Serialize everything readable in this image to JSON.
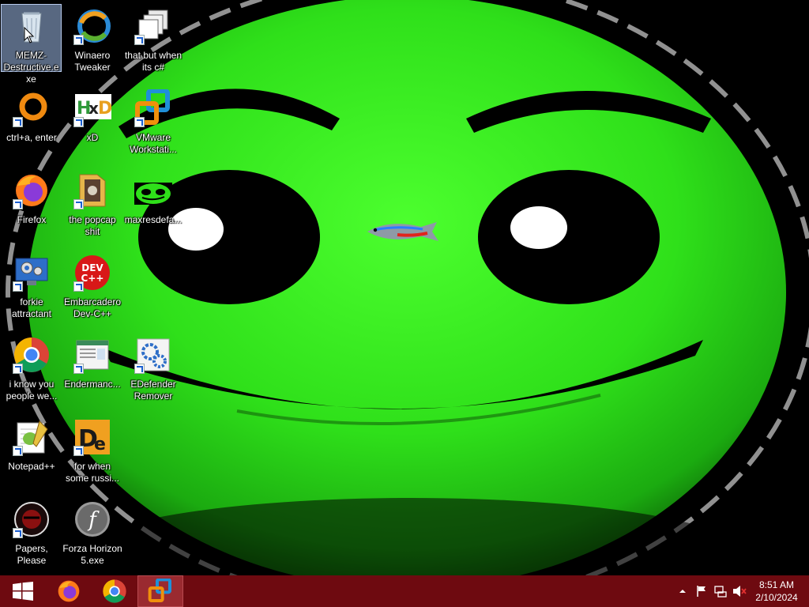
{
  "desktop": {
    "icons": [
      {
        "label": "MEMZ-Destructive.exe",
        "icon": "recycle-bin-icon"
      },
      {
        "label": "Winaero Tweaker",
        "icon": "winaero-icon"
      },
      {
        "label": "that but when its c#",
        "icon": "stacked-windows-icon"
      },
      {
        "label": "ctrl+a, enter",
        "icon": "orange-ring-icon"
      },
      {
        "label": "xD",
        "icon": "hxd-icon"
      },
      {
        "label": "VMware Workstati...",
        "icon": "vmware-icon"
      },
      {
        "label": "Firefox",
        "icon": "firefox-icon"
      },
      {
        "label": "the popcap shit",
        "icon": "folder-icon"
      },
      {
        "label": "maxresdefa...",
        "icon": "green-face-thumbnail-icon"
      },
      {
        "label": "forkie attractant",
        "icon": "monitor-gear-icon"
      },
      {
        "label": "Embarcadero Dev-C++",
        "icon": "devcpp-icon"
      },
      {
        "label": "i know you people we...",
        "icon": "chrome-icon"
      },
      {
        "label": "Endermanc...",
        "icon": "document-window-icon"
      },
      {
        "label": "EDefender Remover",
        "icon": "gears-icon"
      },
      {
        "label": "Notepad++",
        "icon": "notepadpp-icon"
      },
      {
        "label": "for when some russi...",
        "icon": "die-icon"
      },
      {
        "label": "Papers, Please",
        "icon": "papers-please-icon"
      },
      {
        "label": "Forza Horizon 5.exe",
        "icon": "flash-icon"
      }
    ]
  },
  "wallpaper": {
    "subject": "green-smiley-face",
    "colors": {
      "face": "#33e022",
      "eye": "#000000",
      "pupil": "#ffffff",
      "background": "#000000"
    }
  },
  "taskbar": {
    "color": "#6e0a10",
    "buttons": [
      {
        "name": "start-button",
        "icon": "windows-logo-icon"
      },
      {
        "name": "firefox-taskbar-button",
        "icon": "firefox-icon"
      },
      {
        "name": "chrome-taskbar-button",
        "icon": "chrome-icon"
      },
      {
        "name": "vmware-taskbar-button",
        "icon": "vmware-icon",
        "active": true
      }
    ],
    "tray": {
      "icons": [
        "chevron-up-icon",
        "flag-icon",
        "network-icon",
        "volume-muted-icon"
      ],
      "time": "8:51 AM",
      "date": "2/10/2024"
    }
  }
}
